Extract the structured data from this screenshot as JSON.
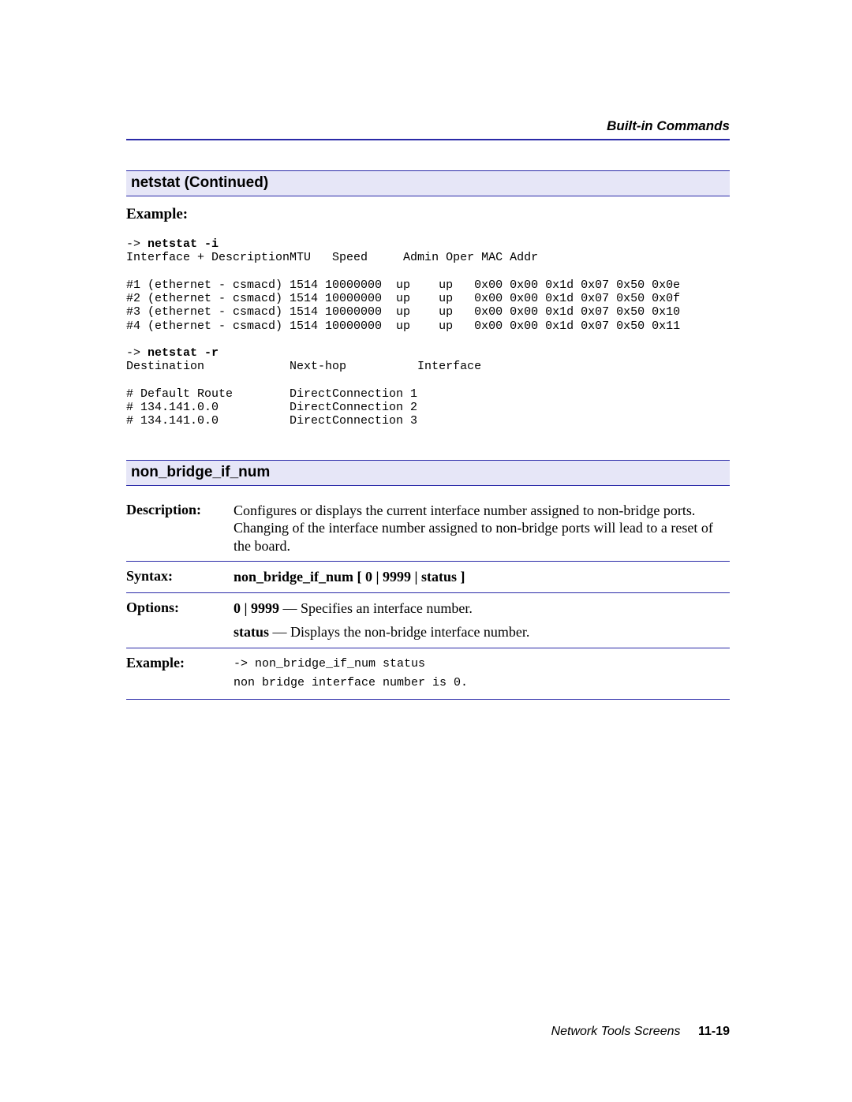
{
  "header": {
    "running_head": "Built-in Commands"
  },
  "section1": {
    "title": "netstat (Continued)",
    "example_label": "Example:",
    "pre_1": "-> ",
    "cmd_1": "netstat -i",
    "pre_hdr": "Interface + DescriptionMTU   Speed     Admin Oper MAC Addr",
    "row1": "#1 (ethernet - csmacd) 1514 10000000  up    up   0x00 0x00 0x1d 0x07 0x50 0x0e",
    "row2": "#2 (ethernet - csmacd) 1514 10000000  up    up   0x00 0x00 0x1d 0x07 0x50 0x0f",
    "row3": "#3 (ethernet - csmacd) 1514 10000000  up    up   0x00 0x00 0x1d 0x07 0x50 0x10",
    "row4": "#4 (ethernet - csmacd) 1514 10000000  up    up   0x00 0x00 0x1d 0x07 0x50 0x11",
    "pre_2": "-> ",
    "cmd_2": "netstat -r",
    "pre_hdr2": "Destination            Next-hop          Interface",
    "r_row1": "# Default Route        DirectConnection 1",
    "r_row2": "# 134.141.0.0          DirectConnection 2",
    "r_row3": "# 134.141.0.0          DirectConnection 3"
  },
  "section2": {
    "title": "non_bridge_if_num",
    "rows": {
      "description": {
        "label": "Description:",
        "text": "Configures or displays the current interface number assigned to non-bridge ports. Changing of the interface number assigned to non-bridge ports will lead to a reset of the board."
      },
      "syntax": {
        "label": "Syntax:",
        "text": "non_bridge_if_num  [ 0 | 9999 | status ]"
      },
      "options": {
        "label": "Options:",
        "opt1_b": "0 | 9999",
        "opt1_rest": " — Specifies an interface number.",
        "opt2_b": "status",
        "opt2_rest": " — Displays the non-bridge interface number."
      },
      "example": {
        "label": "Example:",
        "pre": "-> ",
        "cmd": "non_bridge_if_num status",
        "out": "non bridge interface number is 0."
      }
    }
  },
  "footer": {
    "title": "Network Tools Screens",
    "page": "11-19"
  }
}
